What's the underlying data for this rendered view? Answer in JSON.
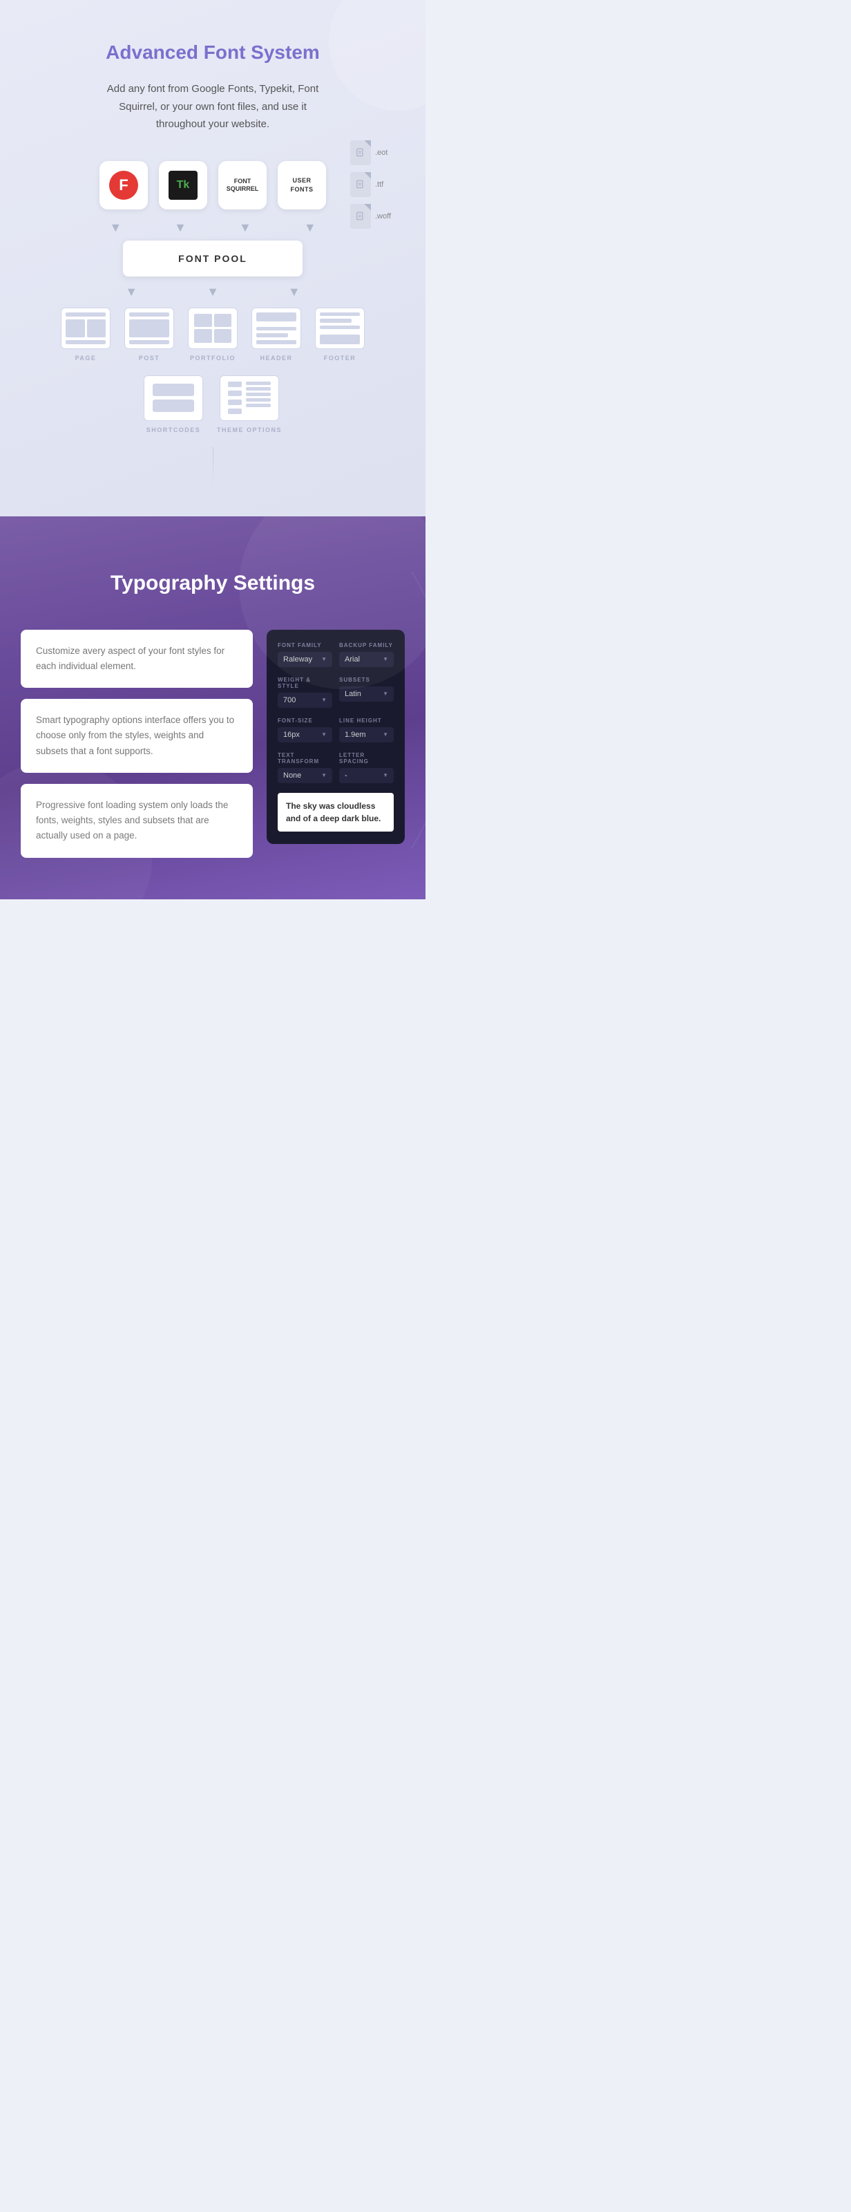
{
  "font_system": {
    "title": "Advanced Font System",
    "description": "Add any font from Google Fonts, Typekit, Font Squirrel, or your own font files, and use it throughout your website.",
    "font_sources": [
      {
        "id": "google",
        "label": "F",
        "type": "google"
      },
      {
        "id": "typekit",
        "label": "Tk",
        "type": "typekit"
      },
      {
        "id": "squirrel",
        "label": "FONT SQUIRREL",
        "type": "squirrel"
      },
      {
        "id": "user",
        "label": "USER FONTS",
        "type": "user"
      }
    ],
    "file_types": [
      ".eot",
      ".ttf",
      ".woff"
    ],
    "font_pool_label": "FONT POOL",
    "layout_items": [
      {
        "id": "page",
        "label": "PAGE"
      },
      {
        "id": "post",
        "label": "POST"
      },
      {
        "id": "portfolio",
        "label": "PORTFOLIO"
      },
      {
        "id": "header",
        "label": "HEADER"
      },
      {
        "id": "footer",
        "label": "FOOTER"
      }
    ],
    "layout_items_2": [
      {
        "id": "shortcodes",
        "label": "SHORTCODES"
      },
      {
        "id": "theme_options",
        "label": "THEME OPTIONS"
      }
    ]
  },
  "typography": {
    "title": "Typography Settings",
    "features": [
      "Customize avery aspect of your font styles for each individual element.",
      "Smart typography options interface offers you to choose only from the styles, weights and subsets that a font supports.",
      "Progressive font loading system only loads the fonts, weights, styles and subsets that are actually used on a page."
    ],
    "settings_panel": {
      "font_family_label": "FONT FAMILY",
      "font_family_value": "Raleway",
      "backup_family_label": "BACKUP FAMILY",
      "backup_family_value": "Arial",
      "weight_style_label": "WEIGHT & STYLE",
      "weight_style_value": "700",
      "subsets_label": "SUBSETS",
      "subsets_value": "Latin",
      "font_size_label": "FONT-SIZE",
      "font_size_value": "16px",
      "line_height_label": "LINE HEIGHT",
      "line_height_value": "1.9em",
      "text_transform_label": "TEXT TRANSFORM",
      "text_transform_value": "None",
      "letter_spacing_label": "LETTER SPACING",
      "letter_spacing_value": "-",
      "preview_text": "The sky was cloudless and of a deep dark blue."
    }
  }
}
